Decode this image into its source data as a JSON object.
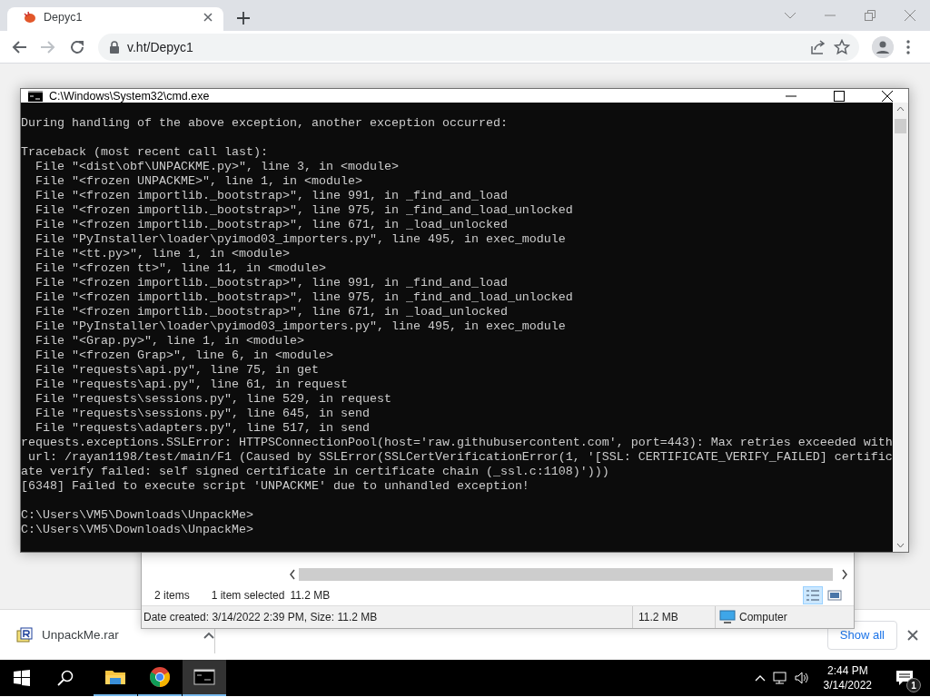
{
  "browser": {
    "tab": {
      "title": "Depyc1",
      "selected": true
    },
    "address": "v.ht/Depyc1"
  },
  "cmd_window": {
    "title": "C:\\Windows\\System32\\cmd.exe",
    "blocks": [
      [
        "During handling of the above exception, another exception occurred:"
      ],
      [
        "Traceback (most recent call last):",
        "  File \"<dist\\obf\\UNPACKME.py>\", line 3, in <module>",
        "  File \"<frozen UNPACKME>\", line 1, in <module>",
        "  File \"<frozen importlib._bootstrap>\", line 991, in _find_and_load",
        "  File \"<frozen importlib._bootstrap>\", line 975, in _find_and_load_unlocked",
        "  File \"<frozen importlib._bootstrap>\", line 671, in _load_unlocked",
        "  File \"PyInstaller\\loader\\pyimod03_importers.py\", line 495, in exec_module",
        "  File \"<tt.py>\", line 1, in <module>",
        "  File \"<frozen tt>\", line 11, in <module>",
        "  File \"<frozen importlib._bootstrap>\", line 991, in _find_and_load",
        "  File \"<frozen importlib._bootstrap>\", line 975, in _find_and_load_unlocked",
        "  File \"<frozen importlib._bootstrap>\", line 671, in _load_unlocked",
        "  File \"PyInstaller\\loader\\pyimod03_importers.py\", line 495, in exec_module",
        "  File \"<Grap.py>\", line 1, in <module>",
        "  File \"<frozen Grap>\", line 6, in <module>",
        "  File \"requests\\api.py\", line 75, in get",
        "  File \"requests\\api.py\", line 61, in request",
        "  File \"requests\\sessions.py\", line 529, in request",
        "  File \"requests\\sessions.py\", line 645, in send",
        "  File \"requests\\adapters.py\", line 517, in send",
        "requests.exceptions.SSLError: HTTPSConnectionPool(host='raw.githubusercontent.com', port=443): Max retries exceeded with",
        " url: /rayan1198/test/main/F1 (Caused by SSLError(SSLCertVerificationError(1, '[SSL: CERTIFICATE_VERIFY_FAILED] certific",
        "ate verify failed: self signed certificate in certificate chain (_ssl.c:1108)')))",
        "[6348] Failed to execute script 'UNPACKME' due to unhandled exception!"
      ],
      [
        "C:\\Users\\VM5\\Downloads\\UnpackMe>",
        "C:\\Users\\VM5\\Downloads\\UnpackMe>"
      ]
    ]
  },
  "explorer_window": {
    "status_bar": {
      "item_count": "2 items",
      "selection": "1 item selected",
      "selection_size": "11.2 MB"
    },
    "view_buttons": [
      {
        "kind": "details",
        "selected": true
      },
      {
        "kind": "preview",
        "selected": false
      }
    ],
    "details_bar": {
      "info": "Date created: 3/14/2022 2:39 PM, Size: 11.2 MB",
      "size": "11.2 MB",
      "location": "Computer"
    }
  },
  "download_bar": {
    "file": "UnpackMe.rar",
    "show_all": "Show all"
  },
  "taskbar": {
    "apps": [
      {
        "kind": "explorer",
        "selected": false
      },
      {
        "kind": "chrome",
        "selected": false
      },
      {
        "kind": "cmd",
        "selected": true
      }
    ],
    "time": "2:44 PM",
    "date": "3/14/2022",
    "notification_count": "1"
  }
}
